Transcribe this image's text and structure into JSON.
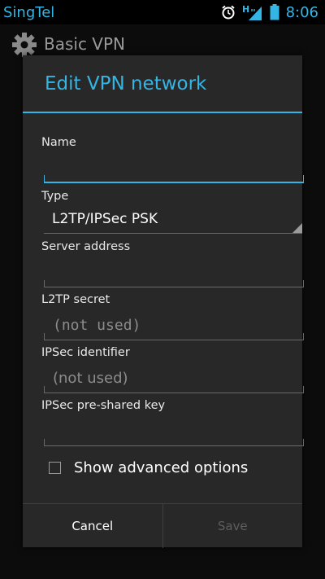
{
  "status_bar": {
    "carrier": "SingTel",
    "time": "8:06",
    "icons": [
      "alarm-icon",
      "hspa-signal-icon",
      "battery-icon"
    ]
  },
  "background": {
    "title": "Basic VPN",
    "icon": "settings-gear-icon"
  },
  "dialog": {
    "title": "Edit VPN network",
    "fields": {
      "name": {
        "label": "Name",
        "value": ""
      },
      "type": {
        "label": "Type",
        "value": "L2TP/IPSec PSK"
      },
      "server": {
        "label": "Server address",
        "value": ""
      },
      "l2tp_secret": {
        "label": "L2TP secret",
        "placeholder": "(not used)"
      },
      "ipsec_identifier": {
        "label": "IPSec identifier",
        "placeholder": "(not used)"
      },
      "ipsec_psk": {
        "label": "IPSec pre-shared key",
        "value": ""
      }
    },
    "advanced": {
      "label": "Show advanced options",
      "checked": false
    },
    "buttons": {
      "cancel": "Cancel",
      "save": "Save"
    }
  },
  "colors": {
    "accent": "#33b5e5",
    "dialog_bg": "#282828",
    "disabled_text": "#5e5e5e"
  }
}
